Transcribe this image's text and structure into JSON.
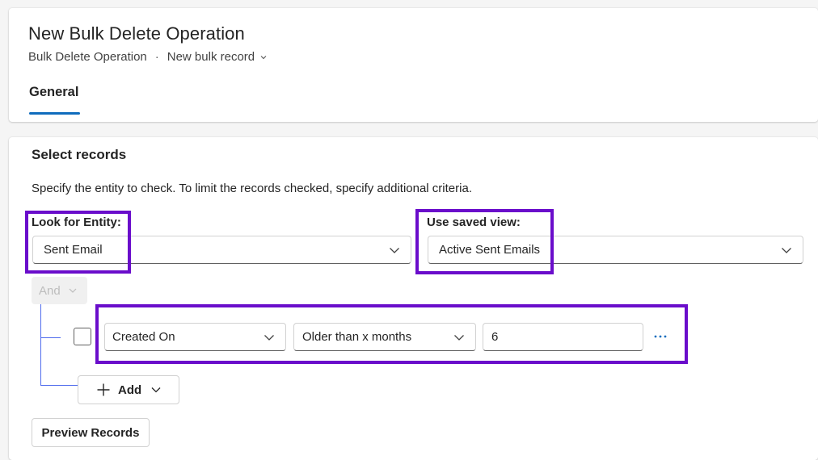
{
  "header": {
    "title": "New Bulk Delete Operation",
    "breadcrumb": {
      "entity": "Bulk Delete Operation",
      "separator": "·",
      "record": "New bulk record"
    },
    "tabs": [
      {
        "label": "General",
        "selected": true
      }
    ]
  },
  "section": {
    "title": "Select records",
    "description": "Specify the entity to check. To limit the records checked, specify additional criteria."
  },
  "entity_field": {
    "label": "Look for Entity:",
    "value": "Sent Email"
  },
  "view_field": {
    "label": "Use saved view:",
    "value": "Active Sent Emails"
  },
  "criteria": {
    "group_operator": "And",
    "rows": [
      {
        "field": "Created On",
        "operator": "Older than x months",
        "value": "6"
      }
    ],
    "add_label": "Add"
  },
  "preview_label": "Preview Records",
  "colors": {
    "accent": "#0f6cbd",
    "highlight": "#6a0dcb",
    "tree_line": "#4f6bed"
  }
}
